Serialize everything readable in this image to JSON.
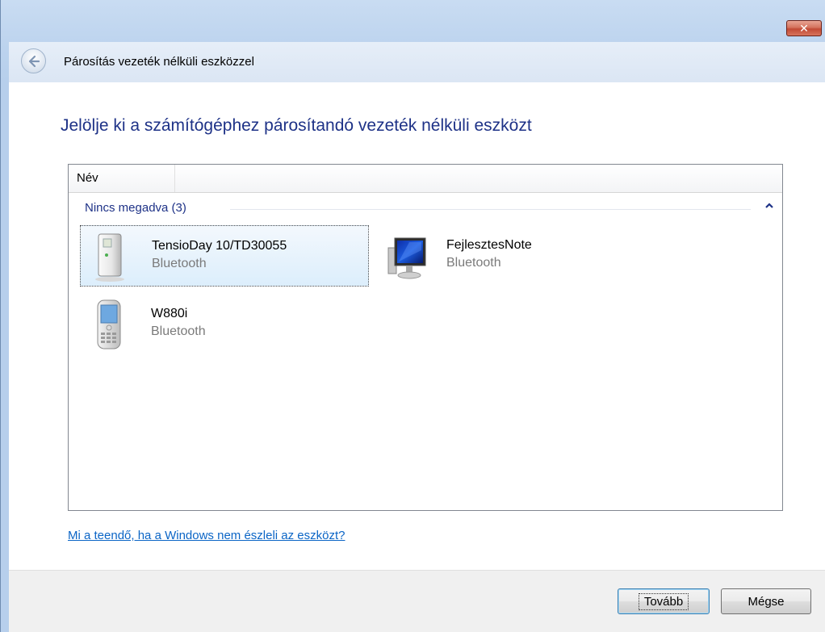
{
  "window": {
    "close_glyph": "✕",
    "header_title": "Párosítás vezeték nélküli eszközzel"
  },
  "main": {
    "instruction": "Jelölje ki a számítógéphez párosítandó vezeték nélküli eszközt",
    "list": {
      "column_header": "Név",
      "group_label": "Nincs megadva (3)",
      "devices": [
        {
          "name": "TensioDay 10/TD30055",
          "type": "Bluetooth",
          "icon": "tower-device-icon",
          "selected": true
        },
        {
          "name": "FejlesztesNote",
          "type": "Bluetooth",
          "icon": "computer-monitor-icon",
          "selected": false
        },
        {
          "name": "W880i",
          "type": "Bluetooth",
          "icon": "mobile-phone-icon",
          "selected": false
        }
      ]
    },
    "help_link": "Mi a teendő, ha a Windows nem észleli az eszközt?"
  },
  "footer": {
    "next_label": "Tovább",
    "cancel_label": "Mégse"
  },
  "colors": {
    "accent": "#1e3287",
    "link": "#0b65c6",
    "selection": "#dceefc"
  }
}
